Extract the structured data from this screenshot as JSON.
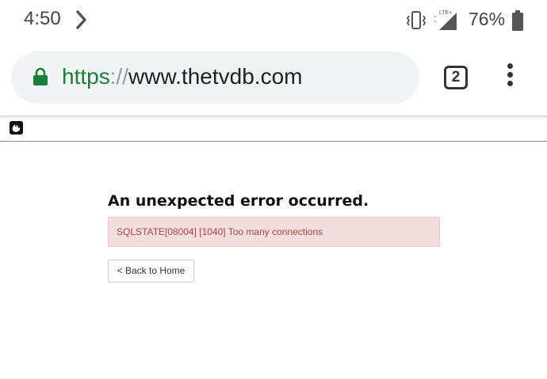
{
  "status_bar": {
    "time": "4:50",
    "battery_percent": "76%",
    "network_label": "LTE+"
  },
  "browser": {
    "url_scheme": "https",
    "url_separator": "://",
    "url_host": "www.thetvdb.com",
    "tab_count": "2",
    "secure_color": "#188038"
  },
  "icons": {
    "notification": "chevron-right-icon",
    "vibrate": "vibrate-icon",
    "signal": "signal-icon",
    "battery": "battery-icon",
    "lock": "lock-icon",
    "menu": "overflow-menu-icon",
    "site": "concrete5-logo-icon"
  },
  "error": {
    "title": "An unexpected error occurred.",
    "message": "SQLSTATE[08004] [1040] Too many connections",
    "box_color": "#f2dede",
    "text_color": "#a94442"
  },
  "actions": {
    "back_label": "< Back to Home"
  }
}
